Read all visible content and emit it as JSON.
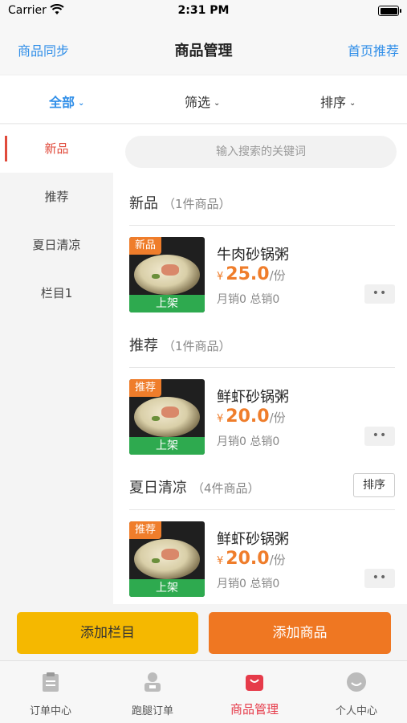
{
  "status_bar": {
    "carrier": "Carrier",
    "time": "2:31 PM"
  },
  "nav": {
    "left": "商品同步",
    "title": "商品管理",
    "right": "首页推荐"
  },
  "filters": [
    {
      "label": "全部",
      "active": true
    },
    {
      "label": "筛选",
      "active": false
    },
    {
      "label": "排序",
      "active": false
    }
  ],
  "sidebar": {
    "items": [
      {
        "label": "新品",
        "active": true
      },
      {
        "label": "推荐",
        "active": false
      },
      {
        "label": "夏日清凉",
        "active": false
      },
      {
        "label": "栏目1",
        "active": false
      }
    ]
  },
  "search": {
    "placeholder": "输入搜索的关键词"
  },
  "sections": [
    {
      "name": "新品",
      "count": "（1件商品）",
      "sort_label": "",
      "product": {
        "badge": "新品",
        "status": "上架",
        "name": "牛肉砂锅粥",
        "currency": "¥",
        "price": "25.0",
        "unit": "/份",
        "sales": "月销0 总销0"
      }
    },
    {
      "name": "推荐",
      "count": "（1件商品）",
      "sort_label": "",
      "product": {
        "badge": "推荐",
        "status": "上架",
        "name": "鲜虾砂锅粥",
        "currency": "¥",
        "price": "20.0",
        "unit": "/份",
        "sales": "月销0 总销0"
      }
    },
    {
      "name": "夏日清凉",
      "count": "（4件商品）",
      "sort_label": "排序",
      "product": {
        "badge": "推荐",
        "status": "上架",
        "name": "鲜虾砂锅粥",
        "currency": "¥",
        "price": "20.0",
        "unit": "/份",
        "sales": "月销0 总销0"
      }
    }
  ],
  "actions": {
    "add_column": "添加栏目",
    "add_product": "添加商品"
  },
  "tabbar": [
    {
      "label": "订单中心",
      "icon": "clipboard-icon",
      "active": false
    },
    {
      "label": "跑腿订单",
      "icon": "courier-icon",
      "active": false
    },
    {
      "label": "商品管理",
      "icon": "shopping-bag-icon",
      "active": true
    },
    {
      "label": "个人中心",
      "icon": "smile-face-icon",
      "active": false
    }
  ],
  "colors": {
    "accent_blue": "#2f8ee8",
    "accent_orange": "#ef7722",
    "accent_yellow": "#f5b800",
    "active_red": "#e04a3b",
    "status_green": "#2eaa4f"
  }
}
